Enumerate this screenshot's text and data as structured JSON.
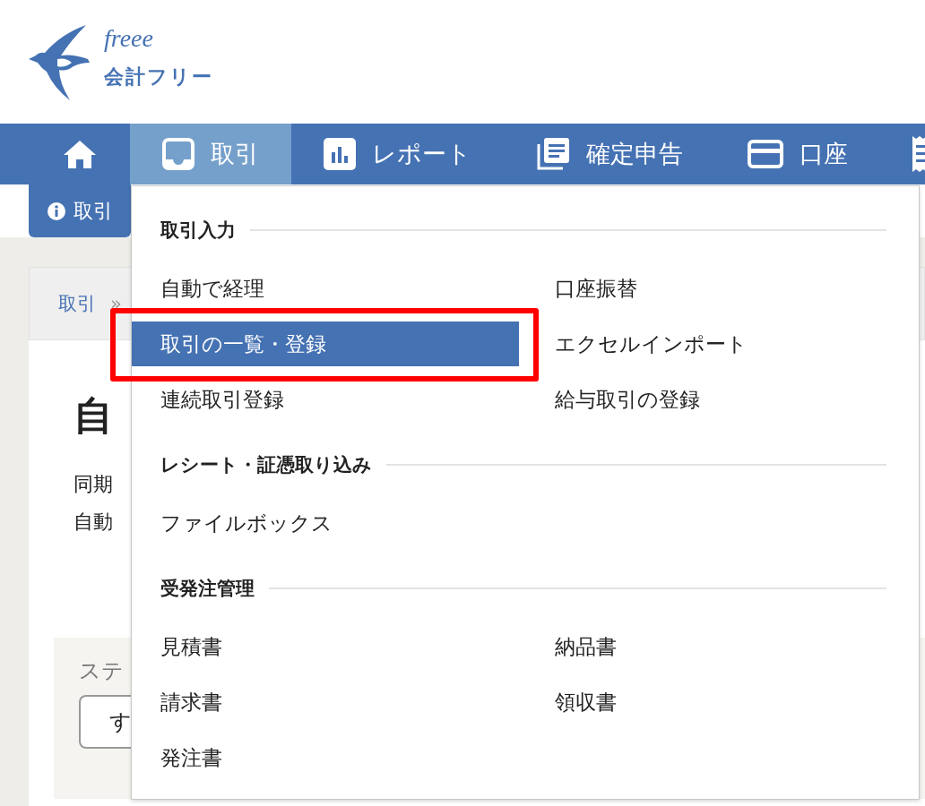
{
  "logo": {
    "wordmark": "freee",
    "product": "会計フリー"
  },
  "nav": [
    {
      "kind": "home",
      "selected": false
    },
    {
      "kind": "deals",
      "label": "取引",
      "selected": true
    },
    {
      "kind": "reports",
      "label": "レポート",
      "selected": false
    },
    {
      "kind": "tax",
      "label": "確定申告",
      "selected": false
    },
    {
      "kind": "accounts",
      "label": "口座",
      "selected": false
    },
    {
      "kind": "more",
      "selected": false
    }
  ],
  "notice": {
    "text": "取引"
  },
  "breadcrumb": {
    "link": "取引",
    "separator": "»"
  },
  "page": {
    "title": "自",
    "lines": [
      "同期",
      "自動"
    ]
  },
  "filter": {
    "label": "ステ",
    "button": "す"
  },
  "menu": {
    "sections": [
      {
        "title": "取引入力",
        "items": [
          {
            "label": "自動で経理",
            "selected": false,
            "outlined": false
          },
          {
            "label": "口座振替",
            "selected": false,
            "outlined": false
          },
          {
            "label": "取引の一覧・登録",
            "selected": true,
            "outlined": true
          },
          {
            "label": "エクセルインポート",
            "selected": false,
            "outlined": false
          },
          {
            "label": "連続取引登録",
            "selected": false,
            "outlined": false
          },
          {
            "label": "給与取引の登録",
            "selected": false,
            "outlined": false
          }
        ]
      },
      {
        "title": "レシート・証憑取り込み",
        "items": [
          {
            "label": "ファイルボックス",
            "selected": false,
            "outlined": false
          }
        ]
      },
      {
        "title": "受発注管理",
        "items": [
          {
            "label": "見積書",
            "selected": false,
            "outlined": false
          },
          {
            "label": "納品書",
            "selected": false,
            "outlined": false
          },
          {
            "label": "請求書",
            "selected": false,
            "outlined": false
          },
          {
            "label": "領収書",
            "selected": false,
            "outlined": false
          },
          {
            "label": "発注書",
            "selected": false,
            "outlined": false
          }
        ]
      }
    ]
  }
}
